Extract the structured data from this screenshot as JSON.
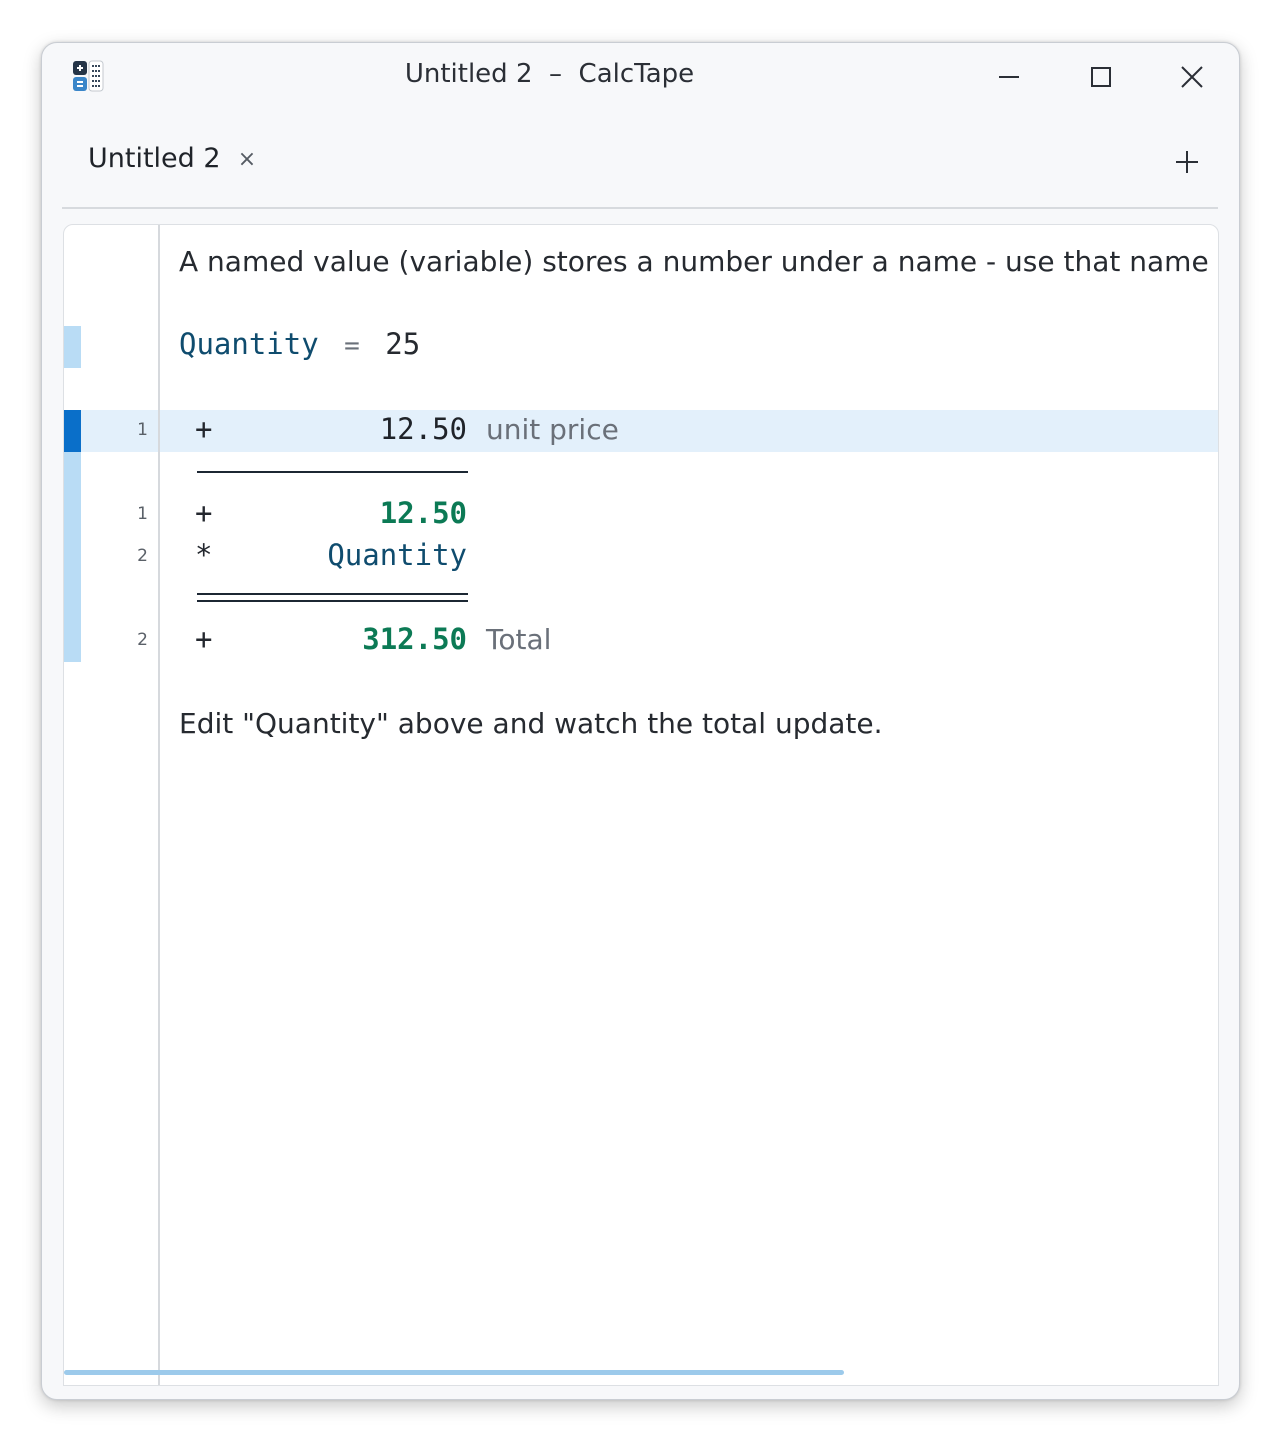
{
  "window": {
    "title": "Untitled 2  –  CalcTape",
    "controls": {
      "minimize": "minimize-icon",
      "maximize": "maximize-icon",
      "close": "close-icon"
    }
  },
  "tabs": [
    {
      "label": "Untitled 2",
      "close_glyph": "×",
      "active": true
    }
  ],
  "new_tab_icon": "plus-icon",
  "document": {
    "intro_text": "A named value (variable) stores a number under a name - use that name anyv",
    "variable": {
      "name": "Quantity",
      "equals": "=",
      "value": "25"
    },
    "tape_1": {
      "line_number": "1",
      "operator": "+",
      "value": "12.50",
      "comment": "unit price"
    },
    "tape_2": [
      {
        "line_number": "1",
        "operator": "+",
        "value": "12.50"
      },
      {
        "line_number": "2",
        "operator": "*",
        "value": "Quantity"
      }
    ],
    "result": {
      "line_number": "2",
      "operator": "+",
      "value": "312.50",
      "comment": "Total"
    },
    "footer_text": "Edit \"Quantity\" above and watch the total update."
  },
  "colors": {
    "variable_name": "#0f4c6e",
    "result_green": "#0c7a55",
    "accent_blue": "#0a6fc9",
    "margin_light_blue": "#b9dcf5",
    "current_line_bg": "#e3f0fb"
  }
}
